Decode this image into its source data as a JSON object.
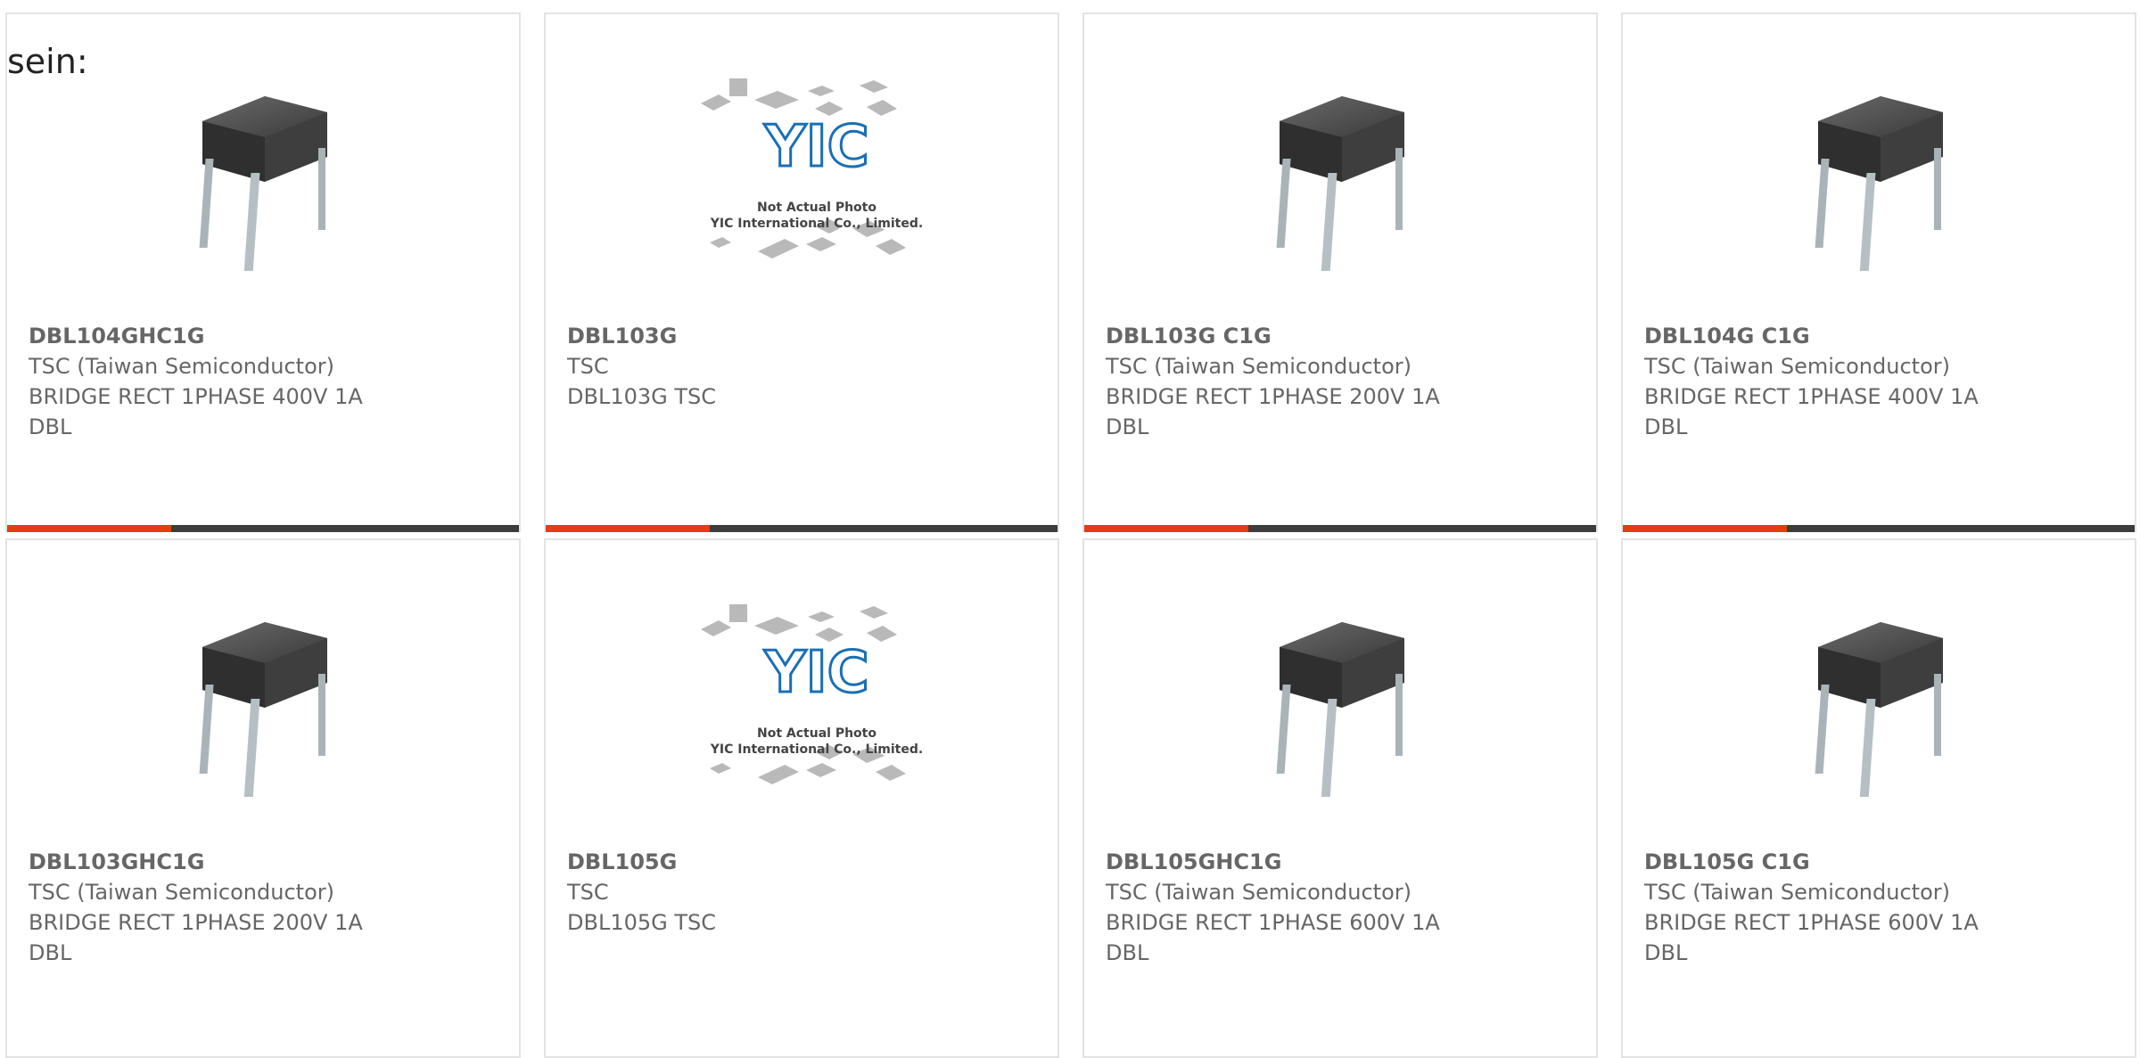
{
  "intro_text": "sein:",
  "cards": [
    {
      "part": "DBL104GHC1G",
      "mfr": "TSC (Taiwan Semiconductor)",
      "desc": "BRIDGE RECT 1PHASE 400V 1A",
      "pkg": "DBL",
      "image": "bridge-rectifier"
    },
    {
      "part": "DBL103G",
      "mfr": "TSC",
      "desc": "DBL103G TSC",
      "pkg": "",
      "image": "placeholder"
    },
    {
      "part": "DBL103G C1G",
      "mfr": "TSC (Taiwan Semiconductor)",
      "desc": "BRIDGE RECT 1PHASE 200V 1A",
      "pkg": "DBL",
      "image": "bridge-rectifier"
    },
    {
      "part": "DBL104G C1G",
      "mfr": "TSC (Taiwan Semiconductor)",
      "desc": "BRIDGE RECT 1PHASE 400V 1A",
      "pkg": "DBL",
      "image": "bridge-rectifier"
    },
    {
      "part": "DBL103GHC1G",
      "mfr": "TSC (Taiwan Semiconductor)",
      "desc": "BRIDGE RECT 1PHASE 200V 1A",
      "pkg": "DBL",
      "image": "bridge-rectifier"
    },
    {
      "part": "DBL105G",
      "mfr": "TSC",
      "desc": "DBL105G TSC",
      "pkg": "",
      "image": "placeholder"
    },
    {
      "part": "DBL105GHC1G",
      "mfr": "TSC (Taiwan Semiconductor)",
      "desc": "BRIDGE RECT 1PHASE 600V 1A",
      "pkg": "DBL",
      "image": "bridge-rectifier"
    },
    {
      "part": "DBL105G C1G",
      "mfr": "TSC (Taiwan Semiconductor)",
      "desc": "BRIDGE RECT 1PHASE 600V 1A",
      "pkg": "DBL",
      "image": "bridge-rectifier"
    }
  ],
  "placeholder_image": {
    "logo": "YIC",
    "caption_line1": "Not Actual Photo",
    "caption_line2": "YIC International Co., Limited."
  },
  "colors": {
    "accent_bar": "#e63c14",
    "dark_bar": "#3c3c3c",
    "card_border": "#e3e3e3",
    "text": "#666666",
    "logo_blue": "#1a6fb5"
  }
}
